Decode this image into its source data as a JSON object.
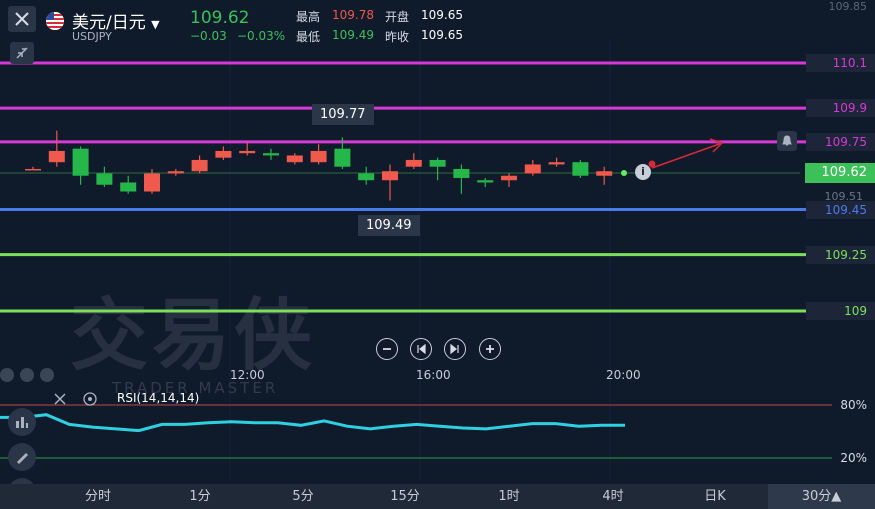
{
  "header": {
    "title": "美元/日元",
    "symbol": "USDJPY",
    "price": "109.62",
    "change": "−0.03",
    "change_pct": "−0.03%",
    "high_label": "最高",
    "high_value": "109.78",
    "open_label": "开盘",
    "open_value": "109.65",
    "low_label": "最低",
    "low_value": "109.49",
    "prev_label": "昨收",
    "prev_value": "109.65",
    "top_right_value": "109.85"
  },
  "level_lines": [
    {
      "value": 110.1,
      "label": "110.1",
      "color": "#d63ad6"
    },
    {
      "value": 109.9,
      "label": "109.9",
      "color": "#d63ad6"
    },
    {
      "value": 109.75,
      "label": "109.75",
      "color": "#d63ad6"
    },
    {
      "value": 109.45,
      "label": "109.45",
      "color": "#4a7bea"
    },
    {
      "value": 109.25,
      "label": "109.25",
      "color": "#7ee05a"
    },
    {
      "value": 109.0,
      "label": "109",
      "color": "#7ee05a"
    }
  ],
  "current_price_tag": "109.62",
  "small_price_tag": "109.51",
  "hi_callout": "109.77",
  "lo_callout": "109.49",
  "watermark": {
    "brand": "交易侠",
    "sub": "TRADER MASTER"
  },
  "time_labels": [
    "12:00",
    "16:00",
    "20:00"
  ],
  "rsi": {
    "label": "RSI(14,14,14)",
    "upper_label": "80%",
    "lower_label": "20%"
  },
  "tabs": [
    "分时",
    "1分",
    "5分",
    "15分",
    "1时",
    "4时",
    "日K",
    "30分▲"
  ],
  "colors": {
    "up": "#ef5a4c",
    "down": "#25b74a",
    "rsi": "#2fd0e0",
    "bg": "#0f1a2b"
  },
  "chart_data": {
    "type": "candlestick",
    "yaxis_unit": "USDJPY",
    "candles": [
      {
        "o": 109.63,
        "h": 109.64,
        "l": 109.63,
        "c": 109.63
      },
      {
        "o": 109.66,
        "h": 109.8,
        "l": 109.64,
        "c": 109.71
      },
      {
        "o": 109.72,
        "h": 109.73,
        "l": 109.56,
        "c": 109.6
      },
      {
        "o": 109.61,
        "h": 109.64,
        "l": 109.55,
        "c": 109.56
      },
      {
        "o": 109.57,
        "h": 109.6,
        "l": 109.52,
        "c": 109.53
      },
      {
        "o": 109.53,
        "h": 109.63,
        "l": 109.52,
        "c": 109.61
      },
      {
        "o": 109.61,
        "h": 109.63,
        "l": 109.6,
        "c": 109.62
      },
      {
        "o": 109.62,
        "h": 109.69,
        "l": 109.61,
        "c": 109.67
      },
      {
        "o": 109.68,
        "h": 109.73,
        "l": 109.67,
        "c": 109.71
      },
      {
        "o": 109.7,
        "h": 109.75,
        "l": 109.69,
        "c": 109.71
      },
      {
        "o": 109.7,
        "h": 109.72,
        "l": 109.67,
        "c": 109.69
      },
      {
        "o": 109.66,
        "h": 109.7,
        "l": 109.65,
        "c": 109.69
      },
      {
        "o": 109.66,
        "h": 109.74,
        "l": 109.65,
        "c": 109.71
      },
      {
        "o": 109.72,
        "h": 109.77,
        "l": 109.63,
        "c": 109.64
      },
      {
        "o": 109.61,
        "h": 109.64,
        "l": 109.56,
        "c": 109.58
      },
      {
        "o": 109.58,
        "h": 109.65,
        "l": 109.49,
        "c": 109.62
      },
      {
        "o": 109.64,
        "h": 109.7,
        "l": 109.63,
        "c": 109.67
      },
      {
        "o": 109.67,
        "h": 109.68,
        "l": 109.58,
        "c": 109.64
      },
      {
        "o": 109.63,
        "h": 109.65,
        "l": 109.52,
        "c": 109.59
      },
      {
        "o": 109.58,
        "h": 109.59,
        "l": 109.55,
        "c": 109.57
      },
      {
        "o": 109.58,
        "h": 109.61,
        "l": 109.55,
        "c": 109.6
      },
      {
        "o": 109.61,
        "h": 109.67,
        "l": 109.6,
        "c": 109.65
      },
      {
        "o": 109.65,
        "h": 109.68,
        "l": 109.64,
        "c": 109.66
      },
      {
        "o": 109.66,
        "h": 109.67,
        "l": 109.59,
        "c": 109.6
      },
      {
        "o": 109.6,
        "h": 109.64,
        "l": 109.56,
        "c": 109.62
      }
    ],
    "rsi_values": [
      66,
      66,
      69,
      58,
      55,
      53,
      51,
      58,
      58,
      60,
      61,
      60,
      60,
      57,
      62,
      56,
      53,
      56,
      58,
      56,
      54,
      53,
      56,
      59,
      59,
      56,
      57,
      57
    ],
    "rsi_range": [
      0,
      100
    ]
  }
}
